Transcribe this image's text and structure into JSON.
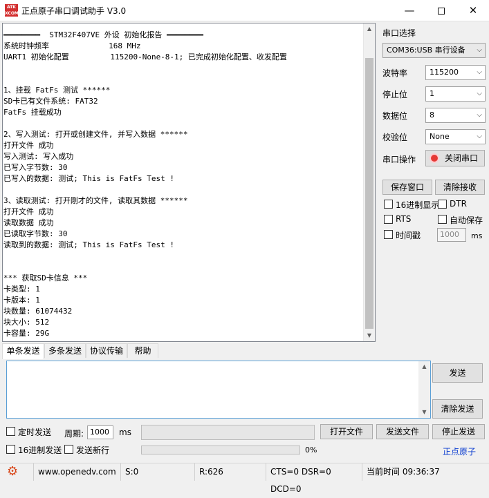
{
  "window": {
    "title": "正点原子串口调试助手 V3.0",
    "logo_text": "ATK XCOM"
  },
  "receive_lines": [
    "════════  STM32F407VE 外设 初始化报告 ════════",
    "系统时钟频率             168 MHz",
    "UART1 初始化配置         115200-None-8-1; 已完成初始化配置、收发配置",
    "",
    "",
    "1、挂载 FatFs 测试 ******",
    "SD卡已有文件系统: FAT32",
    "FatFs 挂载成功",
    "",
    "2、写入测试: 打开或创建文件, 并写入数据 ******",
    "打开文件 成功",
    "写入测试: 写入成功",
    "已写入字节数: 30",
    "已写入的数据: 测试; This is FatFs Test !",
    "",
    "3、读取测试: 打开刚才的文件, 读取其数据 ******",
    "打开文件 成功",
    "读取数据 成功",
    "已读取字节数: 30",
    "读取到的数据: 测试; This is FatFs Test !",
    "",
    "",
    "*** 获取SD卡信息 ***",
    "卡类型: 1",
    "卡版本: 1",
    "块数量: 61074432",
    "块大小: 512",
    "卡容量: 29G"
  ],
  "settings": {
    "port_label": "串口选择",
    "port_value": "COM36:USB 串行设备",
    "baud_label": "波特率",
    "baud_value": "115200",
    "stop_label": "停止位",
    "stop_value": "1",
    "data_label": "数据位",
    "data_value": "8",
    "parity_label": "校验位",
    "parity_value": "None",
    "op_label": "串口操作",
    "close_button": "关闭串口"
  },
  "buttons": {
    "save_window": "保存窗口",
    "clear_receive": "清除接收",
    "send": "发送",
    "clear_send": "清除发送",
    "open_file": "打开文件",
    "send_file": "发送文件",
    "stop_send": "停止发送"
  },
  "options": {
    "hex_display": "16进制显示",
    "dtr": "DTR",
    "rts": "RTS",
    "auto_save": "自动保存",
    "timestamp": "时间戳",
    "timestamp_value": "1000",
    "ms": "ms"
  },
  "tabs": [
    "单条发送",
    "多条发送",
    "协议传输",
    "帮助"
  ],
  "send_options": {
    "timed_send": "定时发送",
    "period_label": "周期:",
    "period_value": "1000",
    "ms": "ms",
    "hex_send": "16进制发送",
    "send_newline": "发送新行",
    "progress_text": "0%",
    "progress": 0
  },
  "link_text": "正点原子",
  "status": {
    "url": "www.openedv.com",
    "sent": "S:0",
    "received": "R:626",
    "lines": "CTS=0 DSR=0 DCD=0",
    "time": "当前时间 09:36:37"
  }
}
